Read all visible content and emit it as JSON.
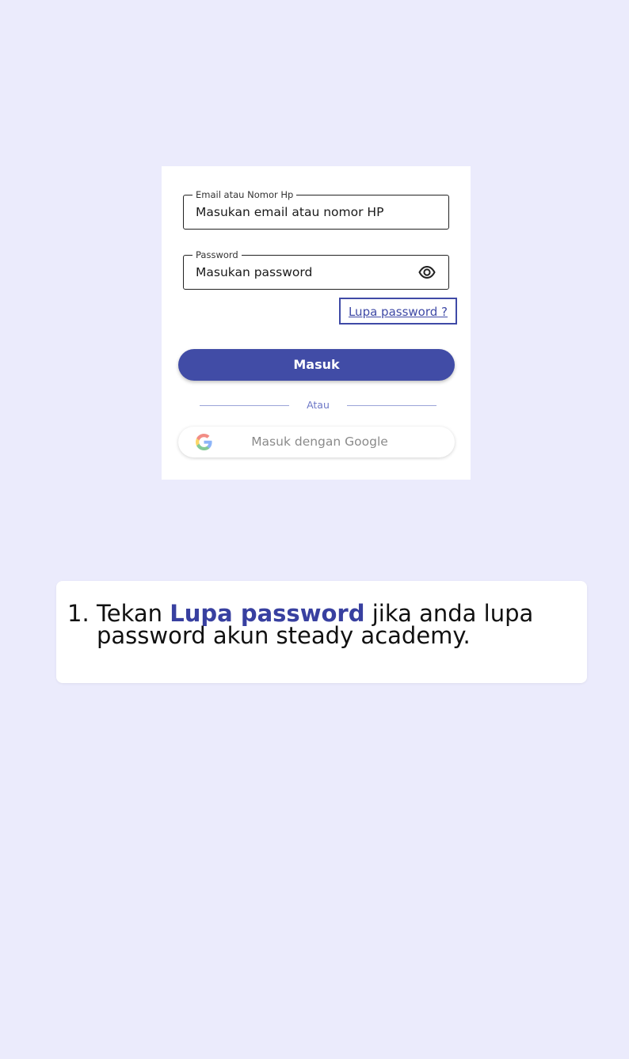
{
  "colors": {
    "page_background": "#ebebfc",
    "primary": "#414ca6",
    "link": "#3f4aa6",
    "highlight": "#3840a0",
    "divider": "#9aa3d8"
  },
  "login": {
    "email_field": {
      "label": "Email atau Nomor Hp",
      "placeholder": "Masukan email atau nomor HP"
    },
    "password_field": {
      "label": "Password",
      "placeholder": "Masukan password",
      "toggle_icon": "eye-icon"
    },
    "forgot_password": "Lupa password ?",
    "submit_label": "Masuk",
    "divider_label": "Atau",
    "google_button": {
      "icon": "google-icon",
      "label": "Masuk dengan Google"
    }
  },
  "instruction": {
    "number": "1.",
    "prefix": "Tekan ",
    "highlight": "Lupa password",
    "suffix": " jika anda lupa password akun steady academy."
  }
}
